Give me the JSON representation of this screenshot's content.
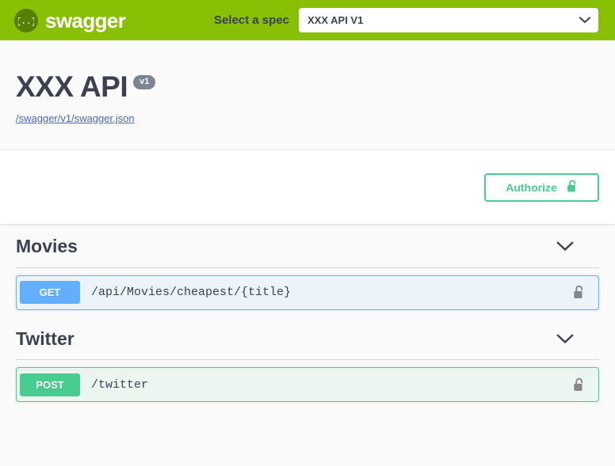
{
  "topbar": {
    "logo_text": "swagger",
    "logo_icon": "swagger-braces-icon",
    "spec_label": "Select a spec",
    "selected_spec": "XXX API V1",
    "spec_options": [
      "XXX API V1"
    ],
    "chevron_icon": "chevron-down-icon",
    "background_color": "#89bf04"
  },
  "info": {
    "title": "XXX API",
    "version_badge": "v1",
    "spec_url": "/swagger/v1/swagger.json"
  },
  "auth": {
    "authorize_label": "Authorize",
    "lock_icon": "unlock-icon",
    "accent_color": "#49cc90"
  },
  "tags": [
    {
      "name": "Movies",
      "arrow_icon": "chevron-down-icon",
      "operations": [
        {
          "method": "GET",
          "path": "/api/Movies/cheapest/{title}",
          "lock_icon": "unlock-icon",
          "method_color": "#61affe",
          "block_background": "#ebf3fb"
        }
      ]
    },
    {
      "name": "Twitter",
      "arrow_icon": "chevron-down-icon",
      "operations": [
        {
          "method": "POST",
          "path": "/twitter",
          "lock_icon": "unlock-icon",
          "method_color": "#49cc90",
          "block_background": "#ecf6f1"
        }
      ]
    }
  ]
}
